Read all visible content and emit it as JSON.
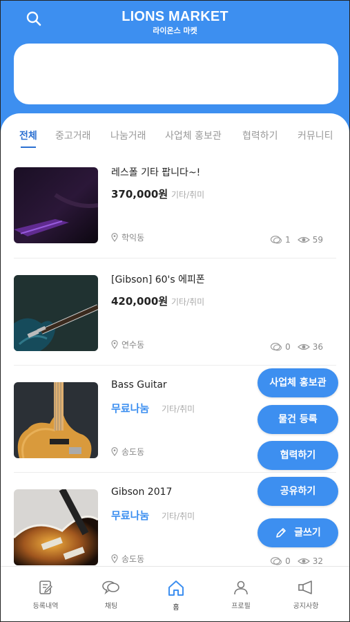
{
  "header": {
    "title": "LIONS MARKET",
    "subtitle": "라이온스 마켓",
    "accent_color": "#3d8ff0",
    "search_icon": "search-icon"
  },
  "tabs": [
    {
      "label": "전체",
      "active": true
    },
    {
      "label": "중고거래",
      "active": false
    },
    {
      "label": "나눔거래",
      "active": false
    },
    {
      "label": "사업체 홍보관",
      "active": false
    },
    {
      "label": "협력하기",
      "active": false
    },
    {
      "label": "커뮤니티",
      "active": false
    }
  ],
  "items": [
    {
      "title": "레스폴 기타 팝니다~!",
      "price": "370,000원",
      "category": "기타/취미",
      "location": "학익동",
      "comments": "1",
      "views": "59"
    },
    {
      "title": "[Gibson] 60's 에피폰",
      "price": "420,000원",
      "category": "기타/취미",
      "location": "연수동",
      "comments": "0",
      "views": "36"
    },
    {
      "title": "Bass Guitar",
      "price": "무료나눔",
      "category": "기타/취미",
      "location": "송도동",
      "comments": "",
      "views": ""
    },
    {
      "title": "Gibson 2017",
      "price": "무료나눔",
      "category": "기타/취미",
      "location": "송도동",
      "comments": "0",
      "views": "32"
    }
  ],
  "fab_menu": {
    "promo": "사업체 홍보관",
    "register": "물건 등록",
    "cooperate": "협력하기",
    "share": "공유하기",
    "write": "글쓰기"
  },
  "bottom_nav": [
    {
      "label": "등록내역",
      "icon": "document-edit-icon"
    },
    {
      "label": "채팅",
      "icon": "chat-icon"
    },
    {
      "label": "홈",
      "icon": "home-icon",
      "active": true
    },
    {
      "label": "프로필",
      "icon": "person-icon"
    },
    {
      "label": "공지사항",
      "icon": "megaphone-icon"
    }
  ]
}
